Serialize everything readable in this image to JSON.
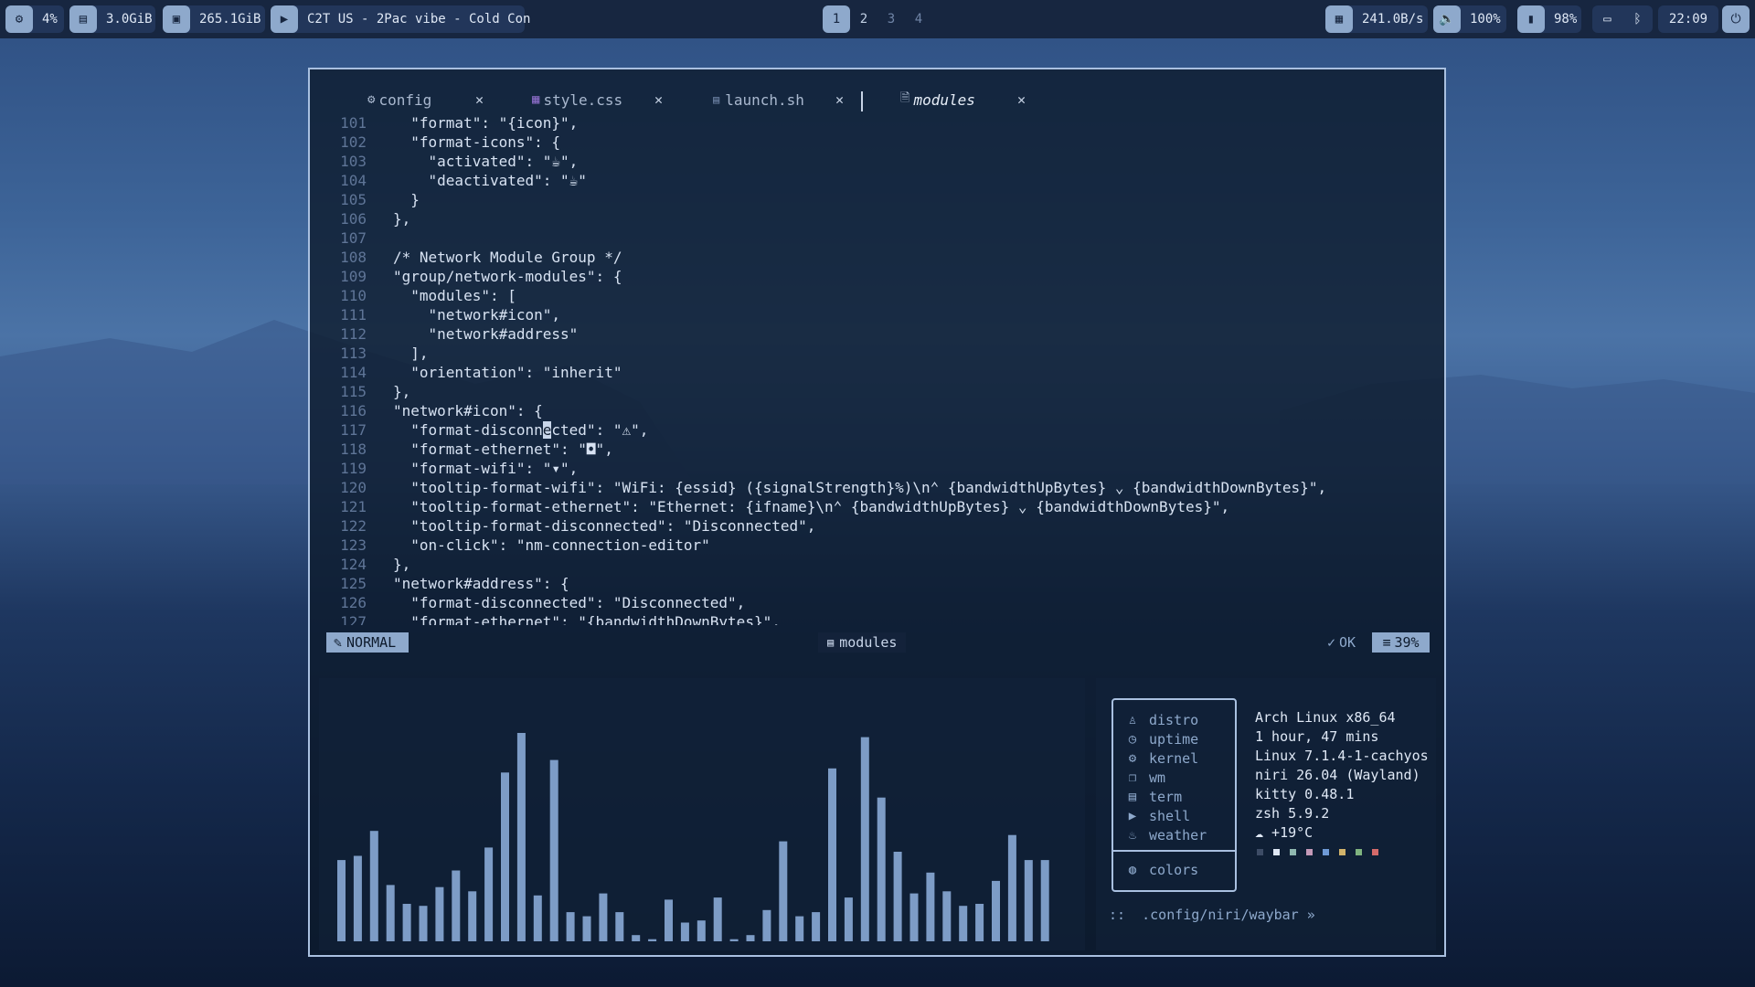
{
  "colors": {
    "accent": "#8ea9cc",
    "border": "#a9c0e0",
    "bar_fill": "#7d9cc6"
  },
  "topbar": {
    "left": [
      {
        "icon": "cpu-icon",
        "glyph": "⚙",
        "text": "4%"
      },
      {
        "icon": "memory-icon",
        "glyph": "▤",
        "text": "3.0GiB"
      },
      {
        "icon": "disk-icon",
        "glyph": "▣",
        "text": "265.1GiB"
      },
      {
        "icon": "play-icon",
        "glyph": "▶",
        "text": "C2T US - 2Pac vibe - Cold Con"
      }
    ],
    "workspaces": [
      "1",
      "2",
      "3",
      "4"
    ],
    "active_workspace": "1",
    "right": [
      {
        "icon": "network-icon",
        "glyph": "▦",
        "text": "241.0B/s"
      },
      {
        "icon": "volume-icon",
        "glyph": "🔈",
        "text": "100%"
      },
      {
        "icon": "battery-icon",
        "glyph": "▮",
        "text": "98%"
      }
    ],
    "clock": "22:09"
  },
  "editor": {
    "tabs": [
      {
        "name": "config",
        "icon": "gear-icon",
        "glyph": "⚙",
        "active": false
      },
      {
        "name": "style.css",
        "icon": "css-file-icon",
        "glyph": "▦",
        "active": false
      },
      {
        "name": "launch.sh",
        "icon": "terminal-file-icon",
        "glyph": "▤",
        "active": false
      },
      {
        "name": "modules",
        "icon": "file-icon",
        "glyph": "🗎",
        "active": true
      }
    ],
    "lines": [
      {
        "n": "101",
        "t": "  \"format\": \"{icon}\","
      },
      {
        "n": "102",
        "t": "  \"format-icons\": {"
      },
      {
        "n": "103",
        "t": "    \"activated\": \"☕\","
      },
      {
        "n": "104",
        "t": "    \"deactivated\": \"☕\""
      },
      {
        "n": "105",
        "t": "  }"
      },
      {
        "n": "106",
        "t": "},"
      },
      {
        "n": "107",
        "t": ""
      },
      {
        "n": "108",
        "t": "/* Network Module Group */"
      },
      {
        "n": "109",
        "t": "\"group/network-modules\": {"
      },
      {
        "n": "110",
        "t": "  \"modules\": ["
      },
      {
        "n": "111",
        "t": "    \"network#icon\","
      },
      {
        "n": "112",
        "t": "    \"network#address\""
      },
      {
        "n": "113",
        "t": "  ],"
      },
      {
        "n": "114",
        "t": "  \"orientation\": \"inherit\""
      },
      {
        "n": "115",
        "t": "},"
      },
      {
        "n": "116",
        "t": "\"network#icon\": {"
      },
      {
        "n": "117",
        "t": "  \"format-disconnected\": \"⚠\",",
        "cursor_col": 17
      },
      {
        "n": "118",
        "t": "  \"format-ethernet\": \"◘\","
      },
      {
        "n": "119",
        "t": "  \"format-wifi\": \"▾\","
      },
      {
        "n": "120",
        "t": "  \"tooltip-format-wifi\": \"WiFi: {essid} ({signalStrength}%)\\n⌃ {bandwidthUpBytes} ⌄ {bandwidthDownBytes}\","
      },
      {
        "n": "121",
        "t": "  \"tooltip-format-ethernet\": \"Ethernet: {ifname}\\n⌃ {bandwidthUpBytes} ⌄ {bandwidthDownBytes}\","
      },
      {
        "n": "122",
        "t": "  \"tooltip-format-disconnected\": \"Disconnected\","
      },
      {
        "n": "123",
        "t": "  \"on-click\": \"nm-connection-editor\""
      },
      {
        "n": "124",
        "t": "},"
      },
      {
        "n": "125",
        "t": "\"network#address\": {"
      },
      {
        "n": "126",
        "t": "  \"format-disconnected\": \"Disconnected\","
      },
      {
        "n": "127",
        "t": "  \"format-ethernet\": \"{bandwidthDownBytes}\","
      }
    ],
    "status": {
      "mode": "NORMAL",
      "file": "modules",
      "check": "OK",
      "percent": "39%"
    }
  },
  "visualizer": {
    "levels": [
      0.39,
      0.41,
      0.53,
      0.27,
      0.18,
      0.17,
      0.26,
      0.34,
      0.24,
      0.45,
      0.81,
      1.0,
      0.22,
      0.87,
      0.14,
      0.12,
      0.23,
      0.14,
      0.03,
      0.01,
      0.2,
      0.09,
      0.1,
      0.21,
      0.01,
      0.03,
      0.15,
      0.48,
      0.12,
      0.14,
      0.83,
      0.21,
      0.98,
      0.69,
      0.43,
      0.23,
      0.33,
      0.24,
      0.17,
      0.18,
      0.29,
      0.51,
      0.39,
      0.39
    ]
  },
  "fetch": {
    "rows": [
      {
        "key": "distro",
        "icon": "distro-icon",
        "glyph": "♙",
        "value": "Arch Linux x86_64"
      },
      {
        "key": "uptime",
        "icon": "clock-icon",
        "glyph": "◷",
        "value": "1 hour, 47 mins"
      },
      {
        "key": "kernel",
        "icon": "gear-icon",
        "glyph": "⚙",
        "value": "Linux 7.1.4-1-cachyos"
      },
      {
        "key": "wm",
        "icon": "window-icon",
        "glyph": "❐",
        "value": "niri 26.04 (Wayland)"
      },
      {
        "key": "term",
        "icon": "terminal-icon",
        "glyph": "▤",
        "value": "kitty 0.48.1"
      },
      {
        "key": "shell",
        "icon": "shell-icon",
        "glyph": "▶",
        "value": "zsh 5.9.2"
      },
      {
        "key": "weather",
        "icon": "weather-icon",
        "glyph": "♨",
        "value": "☁  +19°C"
      }
    ],
    "colors_label": "colors",
    "palette": [
      "#3d4c66",
      "#dfe8f5",
      "#8fb8b0",
      "#c49ab8",
      "#6f9ad6",
      "#d1b36a",
      "#7fb37f",
      "#d46a6a"
    ],
    "prompt": "::  .config/niri/waybar »"
  }
}
